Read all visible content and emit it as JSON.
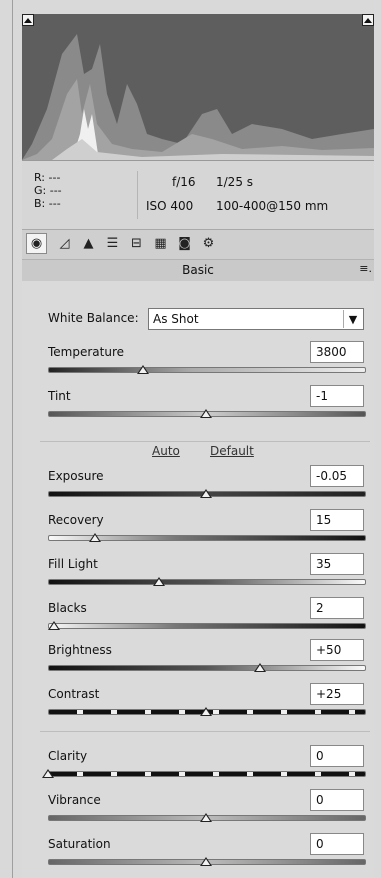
{
  "info": {
    "r_label": "R:",
    "r_value": "---",
    "g_label": "G:",
    "g_value": "---",
    "b_label": "B:",
    "b_value": "---",
    "aperture": "f/16",
    "shutter": "1/25 s",
    "iso": "ISO 400",
    "lens": "100-400@150 mm"
  },
  "tools": [
    {
      "name": "basic-tab-icon",
      "glyph": "◉",
      "active": true
    },
    {
      "name": "tone-curve-tab-icon",
      "glyph": "◿"
    },
    {
      "name": "detail-tab-icon",
      "glyph": "▲"
    },
    {
      "name": "hsl-tab-icon",
      "glyph": "☰"
    },
    {
      "name": "split-toning-tab-icon",
      "glyph": "⊟"
    },
    {
      "name": "lens-corrections-tab-icon",
      "glyph": "▦"
    },
    {
      "name": "camera-calibration-tab-icon",
      "glyph": "◙"
    },
    {
      "name": "presets-tab-icon",
      "glyph": "⚙"
    }
  ],
  "panel": {
    "title": "Basic",
    "menu_glyph": "≡.",
    "white_balance_label": "White Balance:",
    "white_balance_value": "As Shot",
    "auto_link": "Auto",
    "default_link": "Default"
  },
  "sliders": [
    {
      "id": "temperature",
      "label": "Temperature",
      "value": "3800",
      "position": 0.3,
      "track": "temp"
    },
    {
      "id": "tint",
      "label": "Tint",
      "value": "-1",
      "position": 0.5,
      "track": "tint"
    },
    {
      "id": "exposure",
      "label": "Exposure",
      "value": "-0.05",
      "position": 0.5,
      "track": "dark"
    },
    {
      "id": "recovery",
      "label": "Recovery",
      "value": "15",
      "position": 0.15,
      "track": "light-to-dark"
    },
    {
      "id": "fill-light",
      "label": "Fill Light",
      "value": "35",
      "position": 0.35,
      "track": "dark-to-light"
    },
    {
      "id": "blacks",
      "label": "Blacks",
      "value": "2",
      "position": 0.02,
      "track": "light-to-dark"
    },
    {
      "id": "brightness",
      "label": "Brightness",
      "value": "+50",
      "position": 0.67,
      "track": "dark-to-light"
    },
    {
      "id": "contrast",
      "label": "Contrast",
      "value": "+25",
      "position": 0.5,
      "track": "dashed"
    },
    {
      "id": "clarity",
      "label": "Clarity",
      "value": "0",
      "position": 0.0,
      "track": "dashed"
    },
    {
      "id": "vibrance",
      "label": "Vibrance",
      "value": "0",
      "position": 0.5,
      "track": "gray"
    },
    {
      "id": "saturation",
      "label": "Saturation",
      "value": "0",
      "position": 0.5,
      "track": "gray"
    }
  ]
}
